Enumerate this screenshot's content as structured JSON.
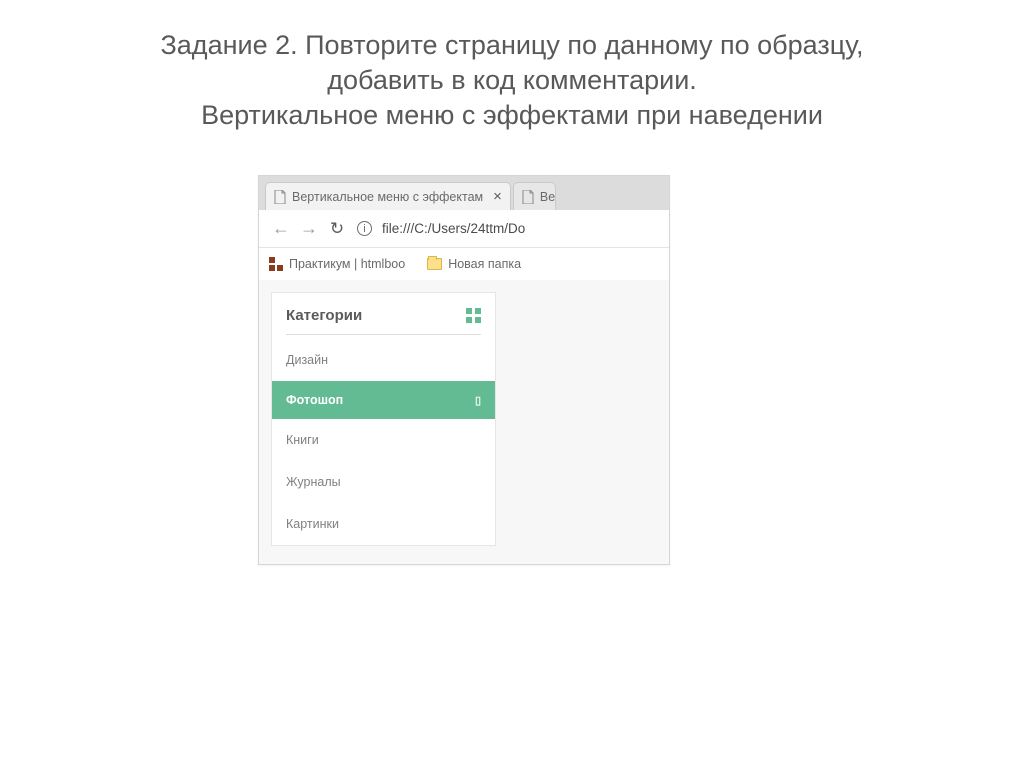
{
  "heading": {
    "line1": "Задание 2. Повторите страницу по данному по образцу,",
    "line2": "добавить в код комментарии.",
    "line3": "Вертикальное меню с эффектами при наведении"
  },
  "browser": {
    "tabs": [
      {
        "title": "Вертикальное меню с эффектам",
        "closable": true
      },
      {
        "title": "Ве",
        "closable": false
      }
    ],
    "address": "file:///C:/Users/24ttm/Do",
    "bookmarks": [
      {
        "label": "Практикум | htmlboo",
        "icon": "html"
      },
      {
        "label": "Новая папка",
        "icon": "folder"
      }
    ]
  },
  "menu": {
    "title": "Категории",
    "items": [
      {
        "label": "Дизайн",
        "active": false
      },
      {
        "label": "Фотошоп",
        "active": true
      },
      {
        "label": "Книги",
        "active": false
      },
      {
        "label": "Журналы",
        "active": false
      },
      {
        "label": "Картинки",
        "active": false
      }
    ]
  },
  "colors": {
    "accent": "#62bb93"
  }
}
